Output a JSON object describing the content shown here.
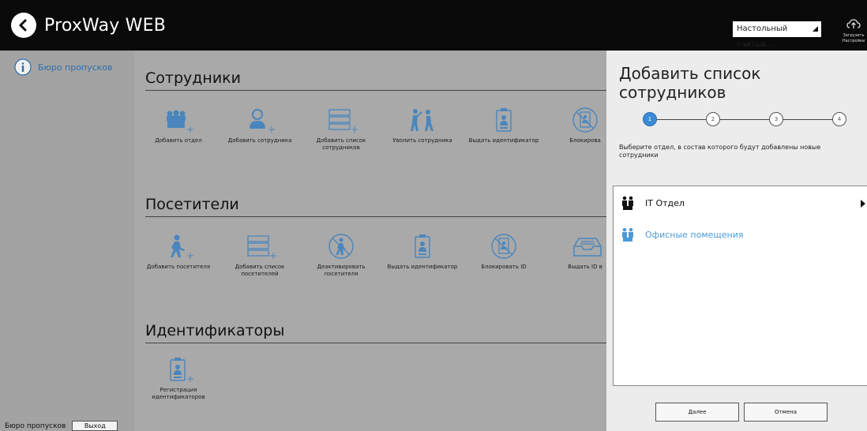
{
  "app": {
    "title": "ProxWay WEB"
  },
  "header": {
    "reader_select": "Настольный считыв...",
    "cloud_label_1": "Загрузить",
    "cloud_label_2": "Настройки"
  },
  "sidebar": {
    "item_label": "Бюро пропусков",
    "footer_label": "Бюро пропусков",
    "exit_button": "Выход"
  },
  "sections": {
    "employees": {
      "title": "Сотрудники",
      "tiles": [
        {
          "label": "Добавить отдел",
          "icon": "add-department-icon"
        },
        {
          "label": "Добавить сотрудника",
          "icon": "add-employee-icon"
        },
        {
          "label": "Добавить список сотрудников",
          "icon": "add-employee-list-icon"
        },
        {
          "label": "Уволить сотрудника",
          "icon": "dismiss-employee-icon"
        },
        {
          "label": "Выдать идентификатор",
          "icon": "issue-id-icon"
        },
        {
          "label": "Блокирова",
          "icon": "block-id-icon"
        }
      ]
    },
    "visitors": {
      "title": "Посетители",
      "tiles": [
        {
          "label": "Добавить посетителя",
          "icon": "add-visitor-icon"
        },
        {
          "label": "Добавить список посетителей",
          "icon": "add-visitor-list-icon"
        },
        {
          "label": "Деактивировать посетителя",
          "icon": "deactivate-visitor-icon"
        },
        {
          "label": "Выдать идентификатор",
          "icon": "issue-id-icon"
        },
        {
          "label": "Блокировать ID",
          "icon": "block-id-icon"
        },
        {
          "label": "Выдать ID в",
          "icon": "tray-icon"
        }
      ]
    },
    "identifiers": {
      "title": "Идентификаторы",
      "tiles": [
        {
          "label": "Регистрация идентификаторов",
          "icon": "register-id-icon"
        }
      ]
    }
  },
  "panel": {
    "title": "Добавить список сотрудников",
    "steps": [
      "1",
      "2",
      "3",
      "4"
    ],
    "active_step": 1,
    "description": "Выберите отдел, в состав которого будут добавлены новые сотрудники",
    "departments": [
      {
        "name": "IT Отдел",
        "color": "#111111",
        "has_children": true
      },
      {
        "name": "Офисные помещения",
        "color": "#4a9ad8",
        "has_children": false
      }
    ],
    "next_button": "Далее",
    "cancel_button": "Отмена"
  },
  "colors": {
    "topbar": "#0a0a0a",
    "sidebar": "#a3a3a3",
    "main": "#a9a9a9",
    "panel": "#ececec",
    "accent": "#3a8ad6",
    "icon": "#4a86bd"
  }
}
